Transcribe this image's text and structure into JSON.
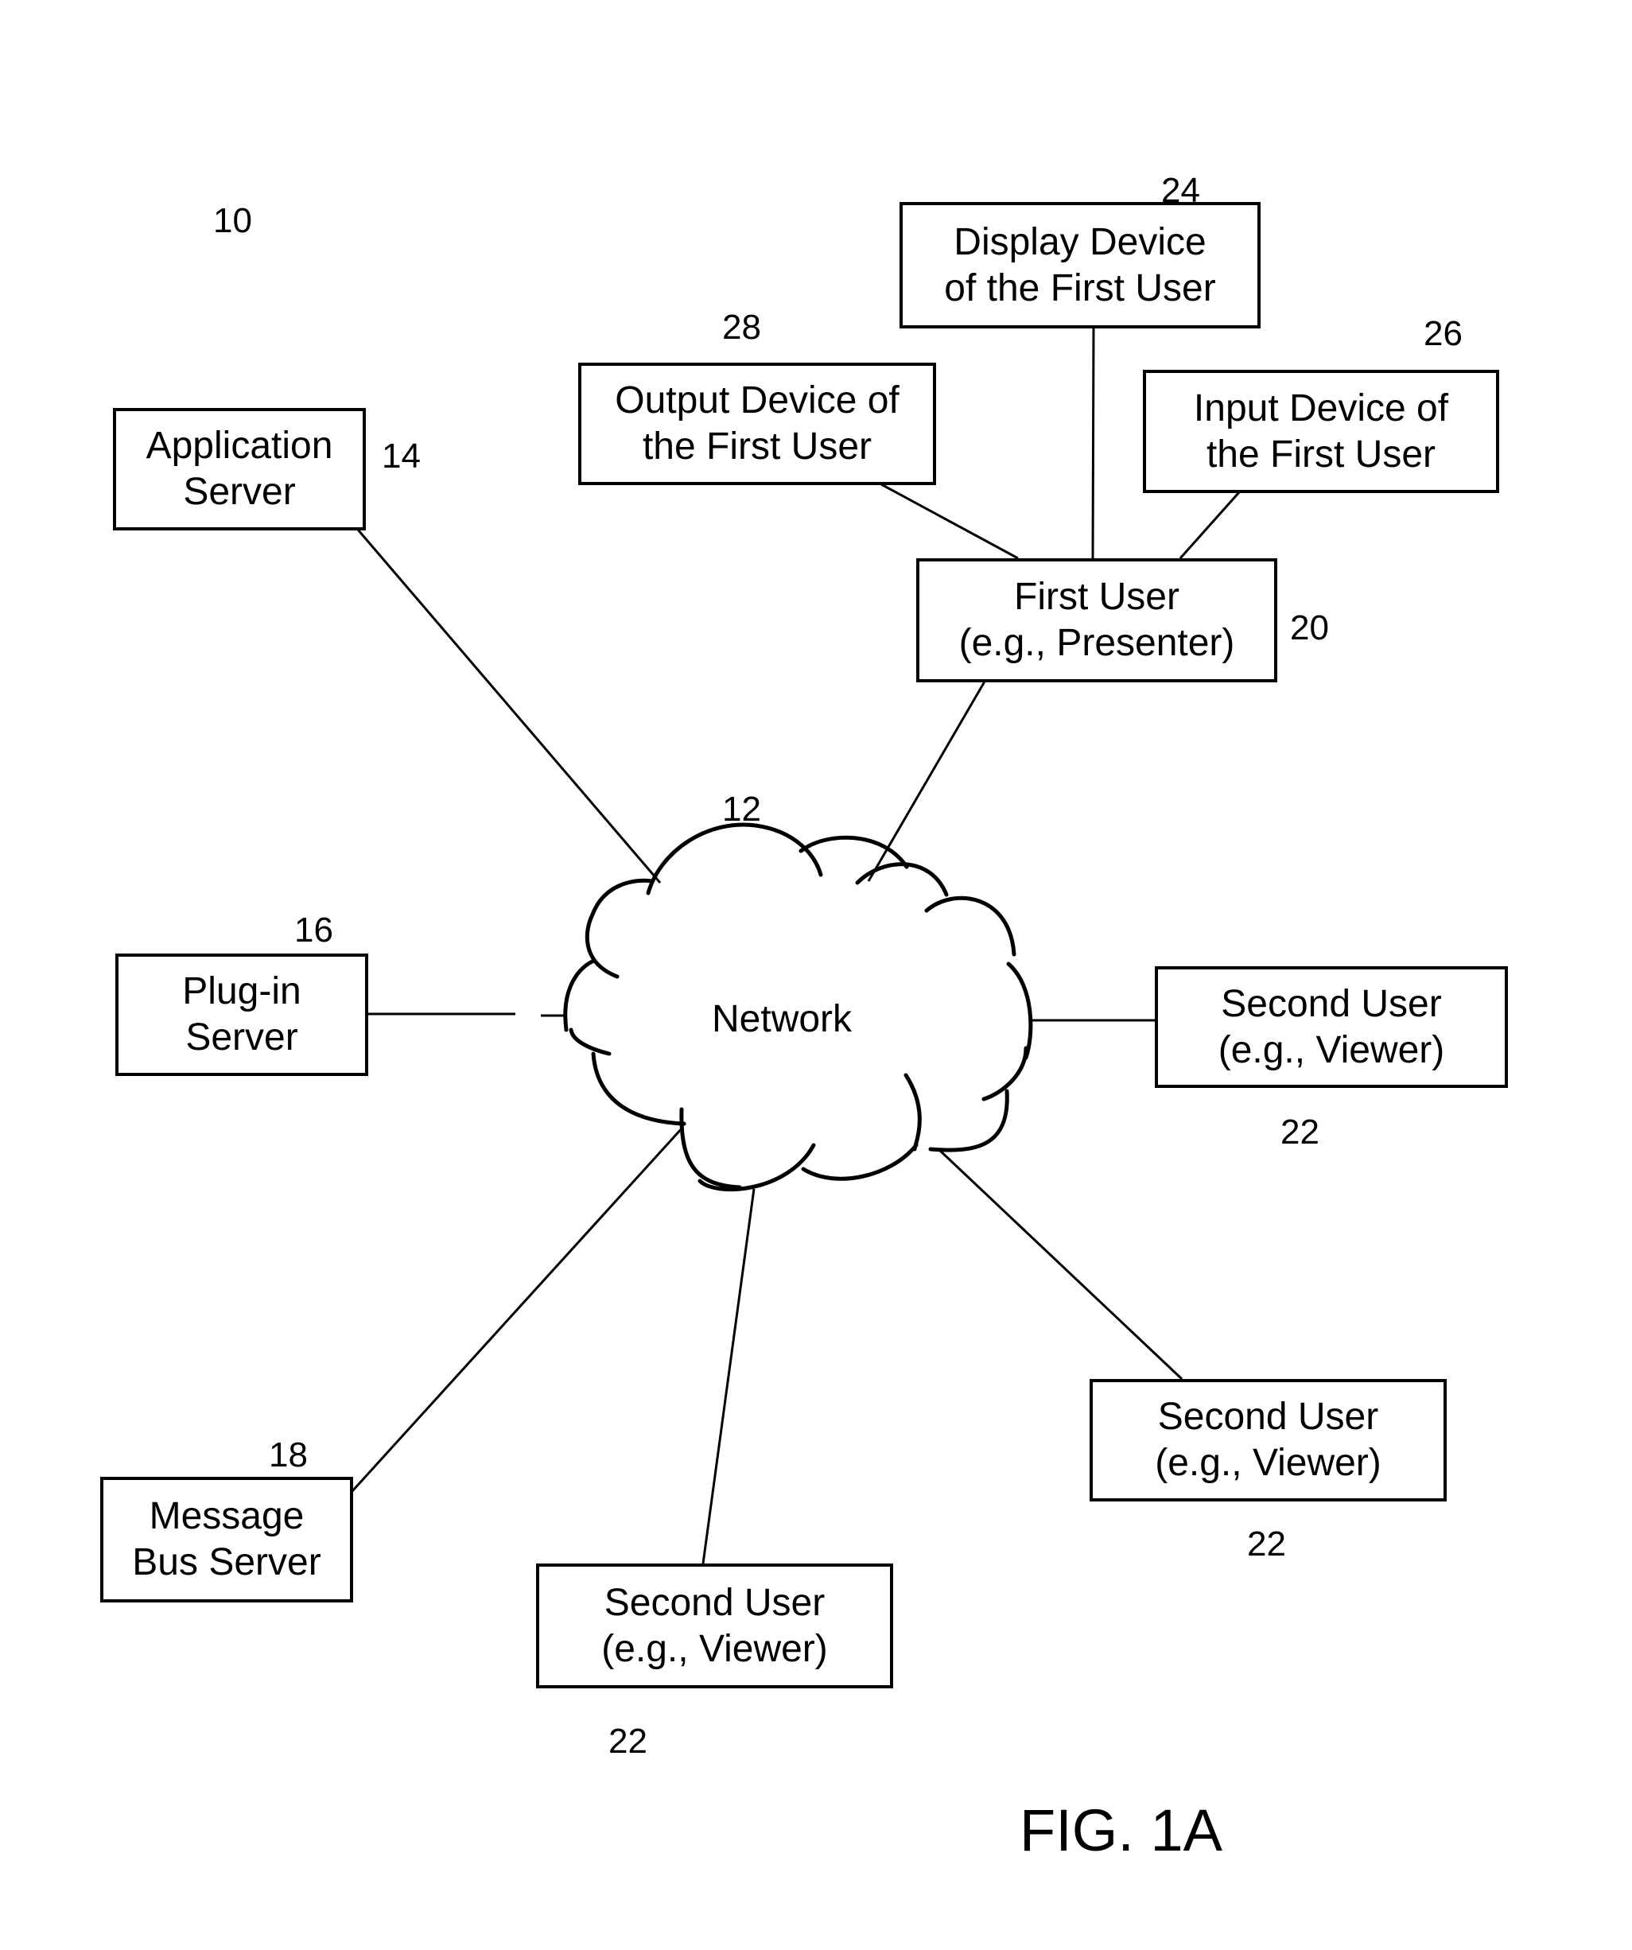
{
  "figure": {
    "label": "FIG. 1A",
    "system_ref": "10"
  },
  "network": {
    "label": "Network",
    "ref": "12"
  },
  "nodes": {
    "application_server": {
      "lines": [
        "Application",
        "Server"
      ],
      "ref": "14"
    },
    "plugin_server": {
      "lines": [
        "Plug-in",
        "Server"
      ],
      "ref": "16"
    },
    "message_bus_server": {
      "lines": [
        "Message",
        "Bus Server"
      ],
      "ref": "18"
    },
    "first_user": {
      "lines": [
        "First User",
        "(e.g., Presenter)"
      ],
      "ref": "20"
    },
    "display_device": {
      "lines": [
        "Display Device",
        "of the First User"
      ],
      "ref": "24"
    },
    "input_device": {
      "lines": [
        "Input Device of",
        "the First User"
      ],
      "ref": "26"
    },
    "output_device": {
      "lines": [
        "Output Device of",
        "the First User"
      ],
      "ref": "28"
    },
    "second_user_right": {
      "lines": [
        "Second User",
        "(e.g., Viewer)"
      ],
      "ref": "22"
    },
    "second_user_lower_right": {
      "lines": [
        "Second User",
        "(e.g., Viewer)"
      ],
      "ref": "22"
    },
    "second_user_bottom": {
      "lines": [
        "Second User",
        "(e.g., Viewer)"
      ],
      "ref": "22"
    }
  },
  "connections": [
    [
      "application_server",
      "network"
    ],
    [
      "plugin_server",
      "network"
    ],
    [
      "message_bus_server",
      "network"
    ],
    [
      "first_user",
      "network"
    ],
    [
      "second_user_right",
      "network"
    ],
    [
      "second_user_lower_right",
      "network"
    ],
    [
      "second_user_bottom",
      "network"
    ],
    [
      "display_device",
      "first_user"
    ],
    [
      "input_device",
      "first_user"
    ],
    [
      "output_device",
      "first_user"
    ]
  ]
}
